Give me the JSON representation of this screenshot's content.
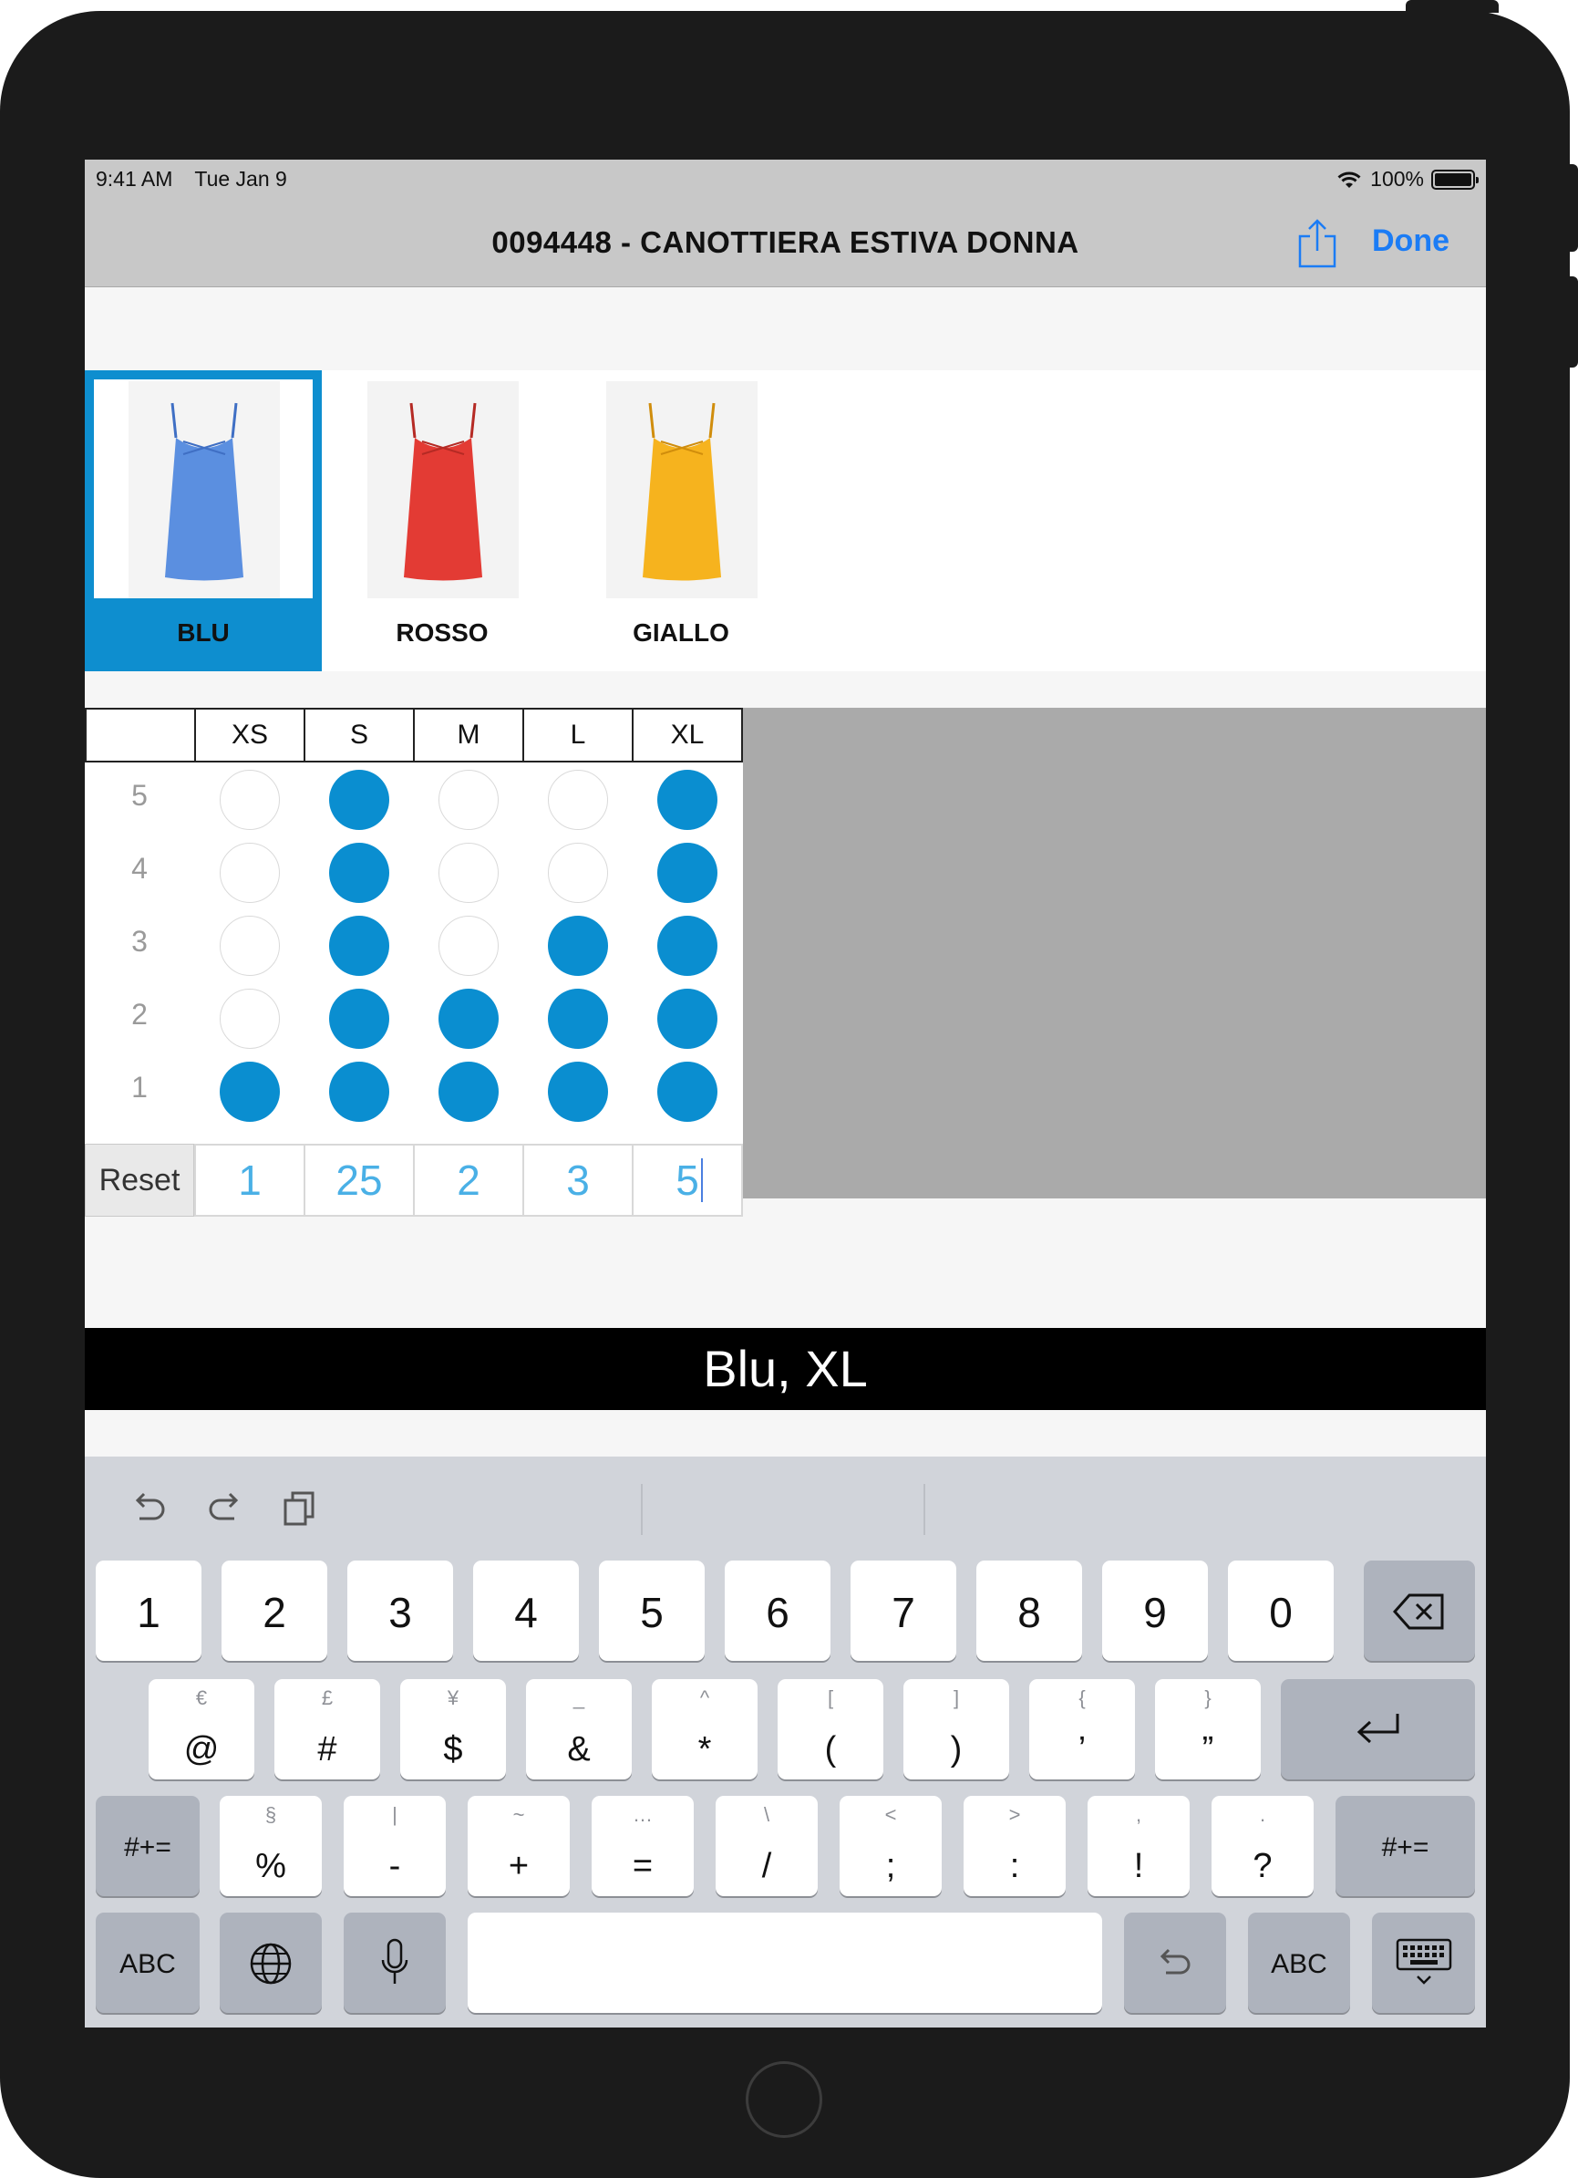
{
  "status_bar": {
    "time": "9:41 AM",
    "date": "Tue Jan 9",
    "battery": "100%"
  },
  "nav": {
    "title": "0094448 - CANOTTIERA ESTIVA DONNA",
    "done_label": "Done",
    "share_icon": "share-icon"
  },
  "colors": [
    {
      "label": "BLU",
      "hex": "#5b8fe0",
      "selected": true
    },
    {
      "label": "ROSSO",
      "hex": "#e33b34",
      "selected": false
    },
    {
      "label": "GIALLO",
      "hex": "#f6b31e",
      "selected": false
    }
  ],
  "grid": {
    "sizes": [
      "XS",
      "S",
      "M",
      "L",
      "XL"
    ],
    "levels": [
      "5",
      "4",
      "3",
      "2",
      "1"
    ],
    "filled": [
      [
        false,
        true,
        false,
        false,
        true
      ],
      [
        false,
        true,
        false,
        false,
        true
      ],
      [
        false,
        true,
        false,
        true,
        true
      ],
      [
        false,
        true,
        true,
        true,
        true
      ],
      [
        true,
        true,
        true,
        true,
        true
      ]
    ],
    "reset_label": "Reset",
    "totals": [
      "1",
      "25",
      "2",
      "3",
      "5"
    ],
    "accent": "#0a8ed0"
  },
  "selection_banner": "Blu, XL",
  "keyboard": {
    "toolbar_icons": [
      "undo-icon",
      "redo-icon",
      "paste-icon"
    ],
    "row1": [
      "1",
      "2",
      "3",
      "4",
      "5",
      "6",
      "7",
      "8",
      "9",
      "0"
    ],
    "row2": [
      {
        "main": "@",
        "alt": "€"
      },
      {
        "main": "#",
        "alt": "£"
      },
      {
        "main": "$",
        "alt": "¥"
      },
      {
        "main": "&",
        "alt": "_"
      },
      {
        "main": "*",
        "alt": "^"
      },
      {
        "main": "(",
        "alt": "["
      },
      {
        "main": ")",
        "alt": "]"
      },
      {
        "main": "’",
        "alt": "{"
      },
      {
        "main": "”",
        "alt": "}"
      }
    ],
    "row3": [
      {
        "main": "%",
        "alt": "§"
      },
      {
        "main": "-",
        "alt": "|"
      },
      {
        "main": "+",
        "alt": "~"
      },
      {
        "main": "=",
        "alt": "…"
      },
      {
        "main": "/",
        "alt": "\\"
      },
      {
        "main": ";",
        "alt": "<"
      },
      {
        "main": ":",
        "alt": ">"
      },
      {
        "main": "!",
        "alt": ","
      },
      {
        "main": "?",
        "alt": "."
      }
    ],
    "shift_label": "#+=",
    "abc_label": "ABC",
    "icons": {
      "delete": "delete-icon",
      "return": "return-icon",
      "globe": "globe-icon",
      "mic": "microphone-icon",
      "undo": "undo-key-icon",
      "dismiss": "keyboard-dismiss-icon"
    }
  }
}
